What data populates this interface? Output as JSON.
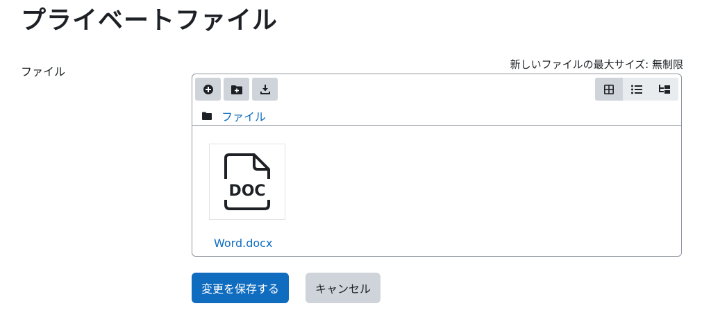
{
  "page": {
    "title": "プライベートファイル"
  },
  "form": {
    "field_label": "ファイル",
    "max_size_text": "新しいファイルの最大サイズ: 無制限"
  },
  "filemanager": {
    "toolbar": [
      {
        "icon": "plus-circle-icon"
      },
      {
        "icon": "folder-plus-icon"
      },
      {
        "icon": "download-icon"
      }
    ],
    "views": [
      {
        "icon": "grid-icon",
        "active": true
      },
      {
        "icon": "list-icon",
        "active": false
      },
      {
        "icon": "tree-icon",
        "active": false
      }
    ],
    "breadcrumb": {
      "folder_label": "ファイル"
    },
    "files": [
      {
        "name": "Word.docx",
        "type_label": "DOC"
      }
    ]
  },
  "actions": {
    "save_label": "変更を保存する",
    "cancel_label": "キャンセル"
  },
  "colors": {
    "link": "#0f6cbf",
    "primary_button": "#0f6cbf",
    "secondary_button": "#ced4da",
    "text": "#1d2125"
  }
}
